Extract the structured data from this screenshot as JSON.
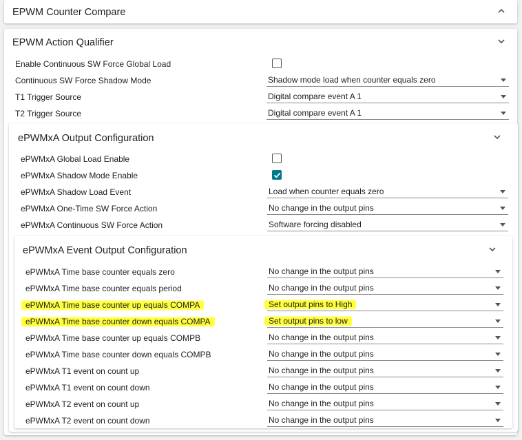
{
  "counter_compare": {
    "title": "EPWM Counter Compare"
  },
  "action_qualifier": {
    "title": "EPWM Action Qualifier",
    "rows": [
      {
        "label": "Enable Continuous SW Force Global Load",
        "checked": false
      },
      {
        "label": "Continuous SW Force Shadow Mode",
        "value": "Shadow mode load when counter equals zero"
      },
      {
        "label": "T1 Trigger Source",
        "value": "Digital compare event A 1"
      },
      {
        "label": "T2 Trigger Source",
        "value": "Digital compare event A 1"
      }
    ]
  },
  "output_config": {
    "title": "ePWMxA Output Configuration",
    "rows": [
      {
        "label": "ePWMxA Global Load Enable",
        "checked": false
      },
      {
        "label": "ePWMxA Shadow Mode Enable",
        "checked": true
      },
      {
        "label": "ePWMxA Shadow Load Event",
        "value": "Load when counter equals zero"
      },
      {
        "label": "ePWMxA One-Time SW Force Action",
        "value": "No change in the output pins"
      },
      {
        "label": "ePWMxA Continuous SW Force Action",
        "value": "Software forcing disabled"
      }
    ]
  },
  "event_output": {
    "title": "ePWMxA Event Output Configuration",
    "rows": [
      {
        "label": "ePWMxA Time base counter equals zero",
        "value": "No change in the output pins"
      },
      {
        "label": "ePWMxA Time base counter equals period",
        "value": "No change in the output pins"
      },
      {
        "label": "ePWMxA Time base counter up equals COMPA",
        "value": "Set output pins to High",
        "highlight": true
      },
      {
        "label": "ePWMxA Time base counter down equals COMPA",
        "value": "Set output pins to low",
        "highlight": true
      },
      {
        "label": "ePWMxA Time base counter up equals COMPB",
        "value": "No change in the output pins"
      },
      {
        "label": "ePWMxA Time base counter down equals COMPB",
        "value": "No change in the output pins"
      },
      {
        "label": "ePWMxA T1 event on count up",
        "value": "No change in the output pins"
      },
      {
        "label": "ePWMxA T1 event on count down",
        "value": "No change in the output pins"
      },
      {
        "label": "ePWMxA T2 event on count up",
        "value": "No change in the output pins"
      },
      {
        "label": "ePWMxA T2 event on count down",
        "value": "No change in the output pins"
      }
    ]
  },
  "colors": {
    "accent": "#00798a",
    "highlight": "#ffff3a"
  },
  "icons": {
    "collapse": "chevron-up-icon",
    "expand": "chevron-down-icon"
  }
}
